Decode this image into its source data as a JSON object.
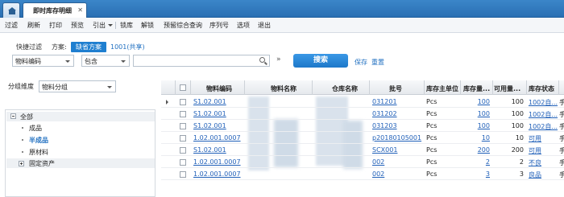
{
  "tabs": {
    "home_icon": "home-icon",
    "document_title": "即时库存明细",
    "close_glyph": "✕"
  },
  "menu": [
    "过滤",
    "刷新",
    "打印",
    "预览",
    "引出",
    "锁库",
    "解锁",
    "预留综合查询",
    "序列号",
    "选项",
    "退出"
  ],
  "filter": {
    "quick_filter_label": "快捷过滤",
    "scheme_label": "方案:",
    "scheme_default": "缺省方案",
    "scheme_shared": "1001(共享)",
    "field_select": "物料编码",
    "operator_select": "包含",
    "value_input": "",
    "search_button": "搜索",
    "save_link": "保存",
    "reset_link": "重置"
  },
  "left_panel": {
    "group_dim_label": "分组维度",
    "group_dim_value": "物料分组",
    "tree": {
      "root": "全部",
      "children": [
        "成品",
        "半成品",
        "原材料",
        "固定资产"
      ]
    }
  },
  "grid": {
    "columns": [
      "物料编码",
      "物料名称",
      "仓库名称",
      "批号",
      "库存主单位",
      "库存量...",
      "可用量...",
      "库存状态"
    ],
    "rows": [
      {
        "code": "S1.02.001",
        "lot": "031201",
        "unit": "Pcs",
        "qty": "100",
        "avail": "100",
        "status": "1002自..."
      },
      {
        "code": "S1.02.001",
        "lot": "031202",
        "unit": "Pcs",
        "qty": "100",
        "avail": "100",
        "status": "1002自..."
      },
      {
        "code": "S1.02.001",
        "lot": "031203",
        "unit": "Pcs",
        "qty": "100",
        "avail": "100",
        "status": "1002自..."
      },
      {
        "code": "1.02.001.0007",
        "lot": "p20180105001",
        "unit": "Pcs",
        "qty": "10",
        "avail": "10",
        "status": "可用"
      },
      {
        "code": "S1.02.001",
        "lot": "SCX001",
        "unit": "Pcs",
        "qty": "200",
        "avail": "200",
        "status": "可用"
      },
      {
        "code": "1.02.001.0007",
        "lot": "002",
        "unit": "Pcs",
        "qty": "2",
        "avail": "2",
        "status": "不良"
      },
      {
        "code": "1.02.001.0007",
        "lot": "002",
        "unit": "Pcs",
        "qty": "3",
        "avail": "3",
        "status": "良品"
      }
    ],
    "trailing_glyph": "手"
  }
}
